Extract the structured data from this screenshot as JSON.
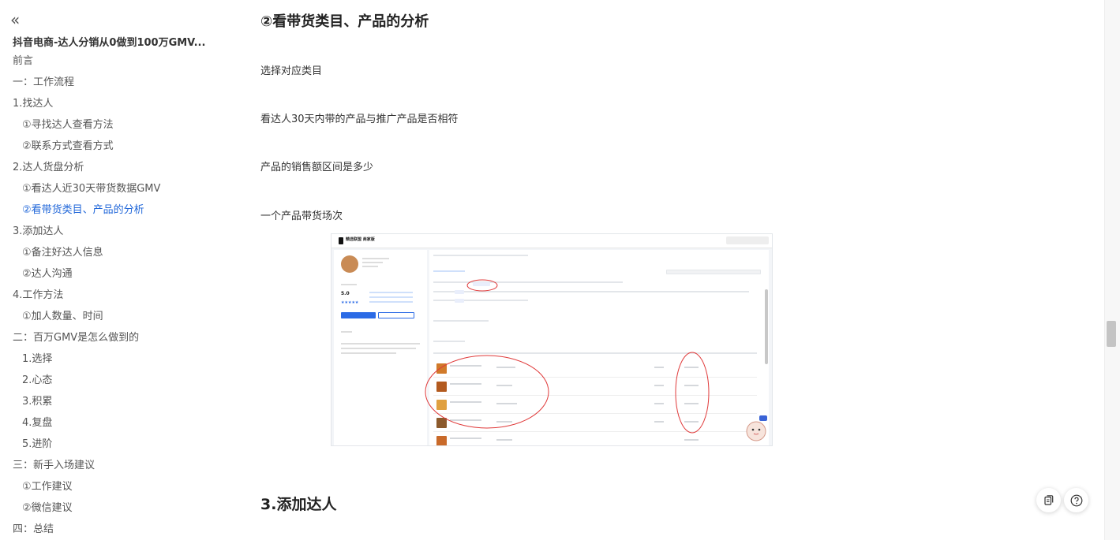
{
  "sidebar": {
    "collapse_glyph": "«",
    "doc_title": "抖音电商-达人分销从0做到100万GMV...",
    "toc": [
      {
        "label": "前言",
        "level": 1
      },
      {
        "label": "一：工作流程",
        "level": 1
      },
      {
        "label": "1.找达人",
        "level": 1
      },
      {
        "label": "①寻找达人查看方法",
        "level": 2
      },
      {
        "label": "②联系方式查看方式",
        "level": 2
      },
      {
        "label": "2.达人货盘分析",
        "level": 1
      },
      {
        "label": "①看达人近30天带货数据GMV",
        "level": 2
      },
      {
        "label": "②看带货类目、产品的分析",
        "level": 2,
        "active": true
      },
      {
        "label": "3.添加达人",
        "level": 1
      },
      {
        "label": "①备注好达人信息",
        "level": 2
      },
      {
        "label": "②达人沟通",
        "level": 2
      },
      {
        "label": "4.工作方法",
        "level": 1
      },
      {
        "label": "①加人数量、时间",
        "level": 2
      },
      {
        "label": "二：百万GMV是怎么做到的",
        "level": 1
      },
      {
        "label": "1.选择",
        "level": 2
      },
      {
        "label": "2.心态",
        "level": 2
      },
      {
        "label": "3.积累",
        "level": 2
      },
      {
        "label": "4.复盘",
        "level": 2
      },
      {
        "label": "5.进阶",
        "level": 2
      },
      {
        "label": "三：新手入场建议",
        "level": 1
      },
      {
        "label": "①工作建议",
        "level": 2
      },
      {
        "label": "②微信建议",
        "level": 2
      },
      {
        "label": "四：总结",
        "level": 1
      }
    ]
  },
  "content": {
    "section_heading": "②看带货类目、产品的分析",
    "paragraphs": [
      "选择对应类目",
      "看达人30天内带的产品与推广产品是否相符",
      "产品的销售额区间是多少",
      "一个产品带货场次"
    ],
    "next_heading": "3.添加达人",
    "screenshot": {
      "logo_text": "精选联盟 商家版",
      "score": "5.0"
    }
  },
  "icons": {
    "collapse": "double-chevron-left-icon",
    "copy": "copy-icon",
    "help": "help-icon"
  },
  "colors": {
    "accent": "#1f66d9",
    "annotation": "#e03a3a"
  }
}
